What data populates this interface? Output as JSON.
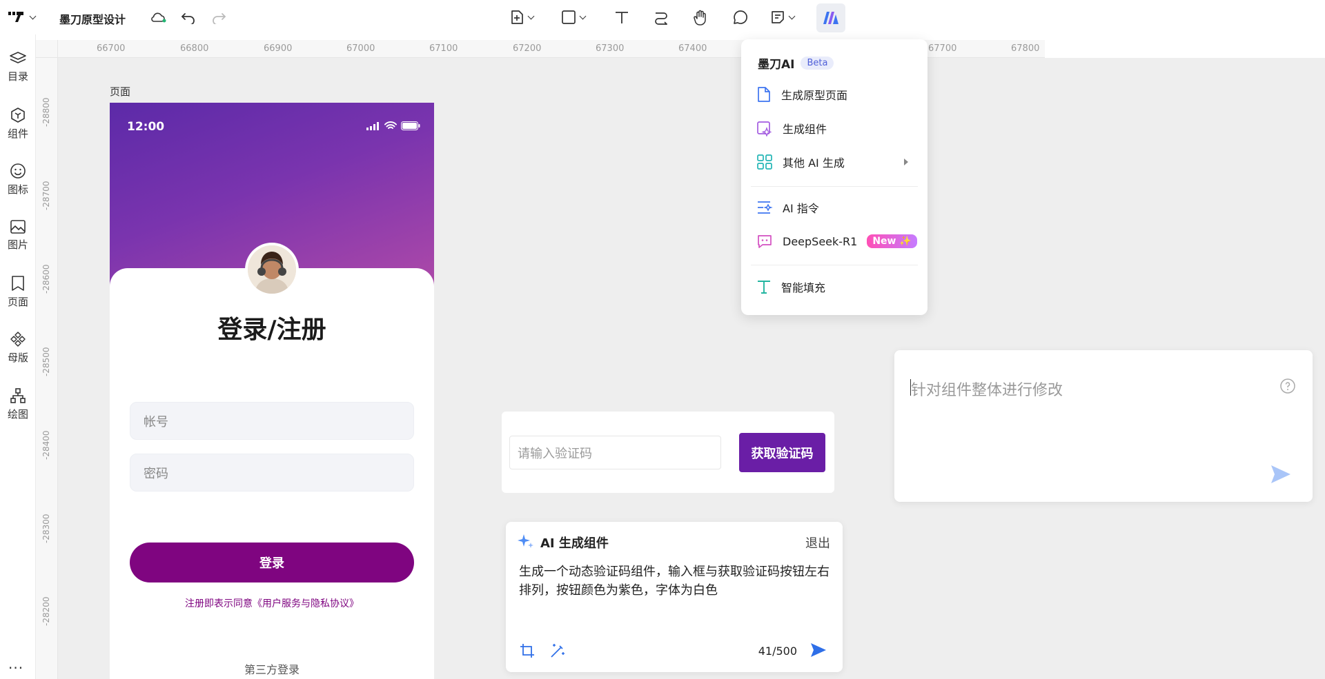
{
  "header": {
    "doc_title": "墨刀原型设计"
  },
  "sidebar": {
    "items": [
      {
        "label": "目录",
        "icon": "layers-icon"
      },
      {
        "label": "组件",
        "icon": "component-icon"
      },
      {
        "label": "图标",
        "icon": "smiley-icon"
      },
      {
        "label": "图片",
        "icon": "image-icon"
      },
      {
        "label": "页面",
        "icon": "page-icon"
      },
      {
        "label": "母版",
        "icon": "master-icon"
      },
      {
        "label": "绘图",
        "icon": "drawing-icon"
      }
    ],
    "more": "..."
  },
  "rulers": {
    "top": [
      "66700",
      "66800",
      "66900",
      "67000",
      "67100",
      "67200",
      "67300",
      "67400",
      "67700",
      "67800"
    ],
    "left": [
      "-28800",
      "-28700",
      "-28600",
      "-28500",
      "-28400",
      "-28300",
      "-28200"
    ]
  },
  "canvas": {
    "page_label": "页面"
  },
  "phone": {
    "time": "12:00",
    "title": "登录/注册",
    "account_placeholder": "帐号",
    "password_placeholder": "密码",
    "login_button": "登录",
    "agreement": "注册即表示同意《用户服务与隐私协议》",
    "third_party": "第三方登录"
  },
  "verify": {
    "input_placeholder": "请输入验证码",
    "button": "获取验证码"
  },
  "ai_panel": {
    "title": "AI 生成组件",
    "exit": "退出",
    "prompt": "生成一个动态验证码组件，输入框与获取验证码按钮左右排列，按钮颜色为紫色，字体为白色",
    "count": "41/500"
  },
  "ai_menu": {
    "title": "墨刀AI",
    "badge": "Beta",
    "items": [
      {
        "label": "生成原型页面",
        "icon": "file-icon"
      },
      {
        "label": "生成组件",
        "icon": "ai-component-icon"
      },
      {
        "label": "其他 AI 生成",
        "icon": "grid-icon"
      },
      {
        "label": "AI 指令",
        "icon": "ai-command-icon"
      },
      {
        "label": "DeepSeek-R1",
        "icon": "chat-bot-icon",
        "badge": "New ✨"
      },
      {
        "label": "智能填充",
        "icon": "text-fill-icon"
      }
    ]
  },
  "edit_panel": {
    "placeholder": "针对组件整体进行修改"
  },
  "colors": {
    "brand_purple": "#7f0580",
    "verify_purple": "#6a1ea6",
    "ai_blue": "#2f6fe8"
  }
}
